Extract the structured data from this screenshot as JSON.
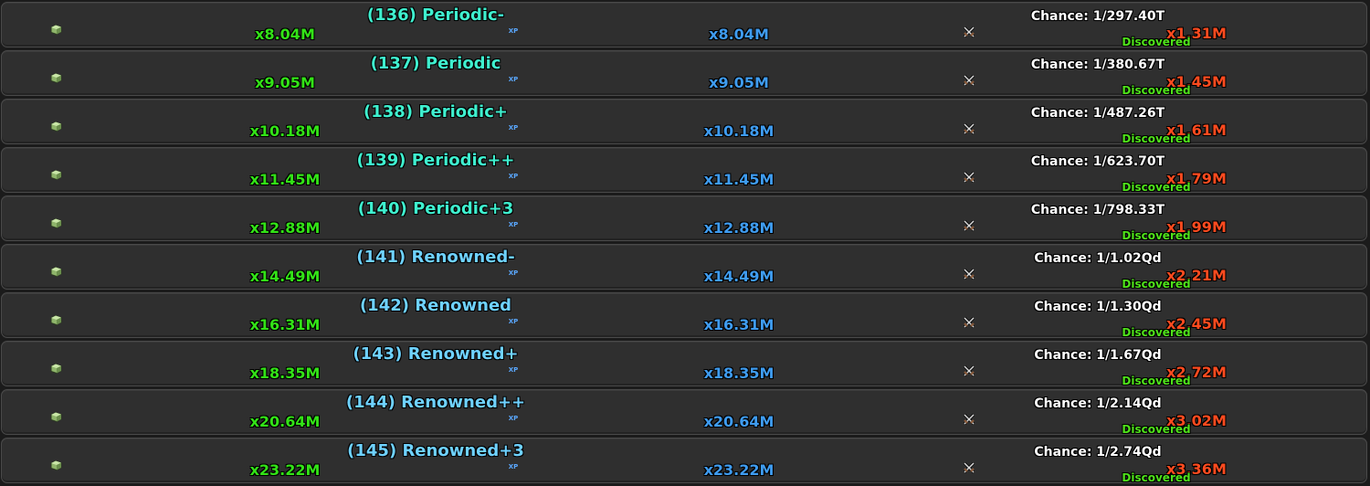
{
  "rarities": [
    {
      "name": "(136) Periodic-",
      "name_color": "#3ff0cf",
      "luck_multiplier": "x8.04M",
      "xp_label": "XP",
      "xp_multiplier": "x8.04M",
      "chance": "Chance: 1/297.40T",
      "value_multiplier": "x1.31M",
      "status": "Discovered"
    },
    {
      "name": "(137) Periodic",
      "name_color": "#3ff0cf",
      "luck_multiplier": "x9.05M",
      "xp_label": "XP",
      "xp_multiplier": "x9.05M",
      "chance": "Chance: 1/380.67T",
      "value_multiplier": "x1.45M",
      "status": "Discovered"
    },
    {
      "name": "(138) Periodic+",
      "name_color": "#3ff0cf",
      "luck_multiplier": "x10.18M",
      "xp_label": "XP",
      "xp_multiplier": "x10.18M",
      "chance": "Chance: 1/487.26T",
      "value_multiplier": "x1.61M",
      "status": "Discovered"
    },
    {
      "name": "(139) Periodic++",
      "name_color": "#3ff0cf",
      "luck_multiplier": "x11.45M",
      "xp_label": "XP",
      "xp_multiplier": "x11.45M",
      "chance": "Chance: 1/623.70T",
      "value_multiplier": "x1.79M",
      "status": "Discovered"
    },
    {
      "name": "(140) Periodic+3",
      "name_color": "#3ff0cf",
      "luck_multiplier": "x12.88M",
      "xp_label": "XP",
      "xp_multiplier": "x12.88M",
      "chance": "Chance: 1/798.33T",
      "value_multiplier": "x1.99M",
      "status": "Discovered"
    },
    {
      "name": "(141) Renowned-",
      "name_color": "#6fd2ff",
      "luck_multiplier": "x14.49M",
      "xp_label": "XP",
      "xp_multiplier": "x14.49M",
      "chance": "Chance: 1/1.02Qd",
      "value_multiplier": "x2.21M",
      "status": "Discovered"
    },
    {
      "name": "(142) Renowned",
      "name_color": "#6fd2ff",
      "luck_multiplier": "x16.31M",
      "xp_label": "XP",
      "xp_multiplier": "x16.31M",
      "chance": "Chance: 1/1.30Qd",
      "value_multiplier": "x2.45M",
      "status": "Discovered"
    },
    {
      "name": "(143) Renowned+",
      "name_color": "#6fd2ff",
      "luck_multiplier": "x18.35M",
      "xp_label": "XP",
      "xp_multiplier": "x18.35M",
      "chance": "Chance: 1/1.67Qd",
      "value_multiplier": "x2.72M",
      "status": "Discovered"
    },
    {
      "name": "(144) Renowned++",
      "name_color": "#6fd2ff",
      "luck_multiplier": "x20.64M",
      "xp_label": "XP",
      "xp_multiplier": "x20.64M",
      "chance": "Chance: 1/2.14Qd",
      "value_multiplier": "x3.02M",
      "status": "Discovered"
    },
    {
      "name": "(145) Renowned+3",
      "name_color": "#6fd2ff",
      "luck_multiplier": "x23.22M",
      "xp_label": "XP",
      "xp_multiplier": "x23.22M",
      "chance": "Chance: 1/2.74Qd",
      "value_multiplier": "x3.36M",
      "status": "Discovered"
    }
  ],
  "icons": {
    "row_icon": "gem-icon",
    "action_icon": "crossed-swords-icon"
  },
  "colors": {
    "luck_multiplier": "#33e317",
    "xp_multiplier": "#3f9cf0",
    "value_multiplier": "#ff4b1f",
    "discovered": "#4fe21a"
  }
}
